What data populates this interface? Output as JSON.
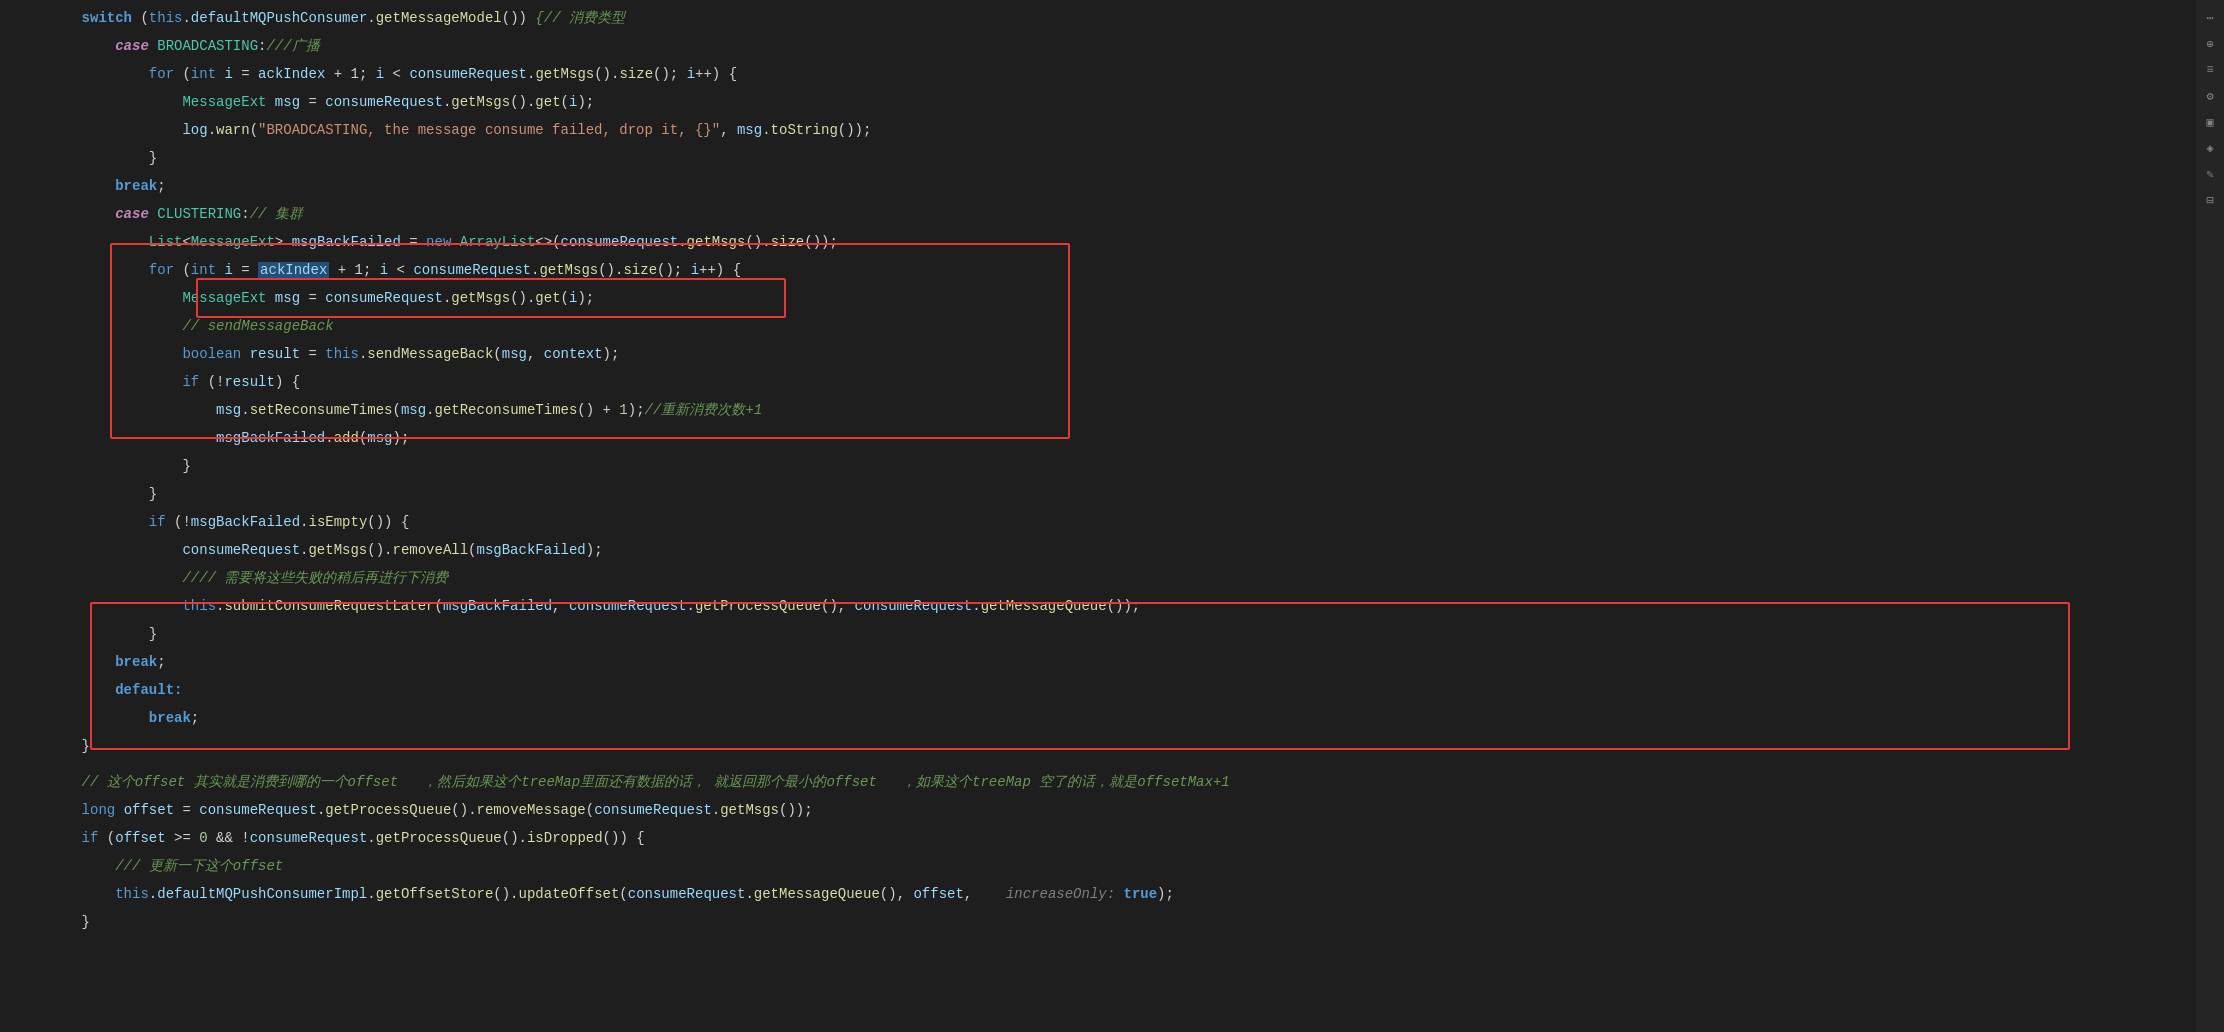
{
  "editor": {
    "background": "#1e1e1e",
    "font_size": "14px"
  },
  "lines": [
    {
      "indent": 2,
      "content": "switch_line",
      "text": "switch (this.defaultMQPushConsumer.getMessageModel()) {// 消费类型"
    },
    {
      "indent": 3,
      "content": "case_broadcasting",
      "text": "case BROADCASTING:///广播"
    },
    {
      "indent": 4,
      "content": "for_broadcasting",
      "text": "for (int i = ackIndex + 1; i < consumeRequest.getMsgs().size(); i++) {"
    },
    {
      "indent": 5,
      "content": "messageext_broadcasting",
      "text": "MessageExt msg = consumeRequest.getMsgs().get(i);"
    },
    {
      "indent": 5,
      "content": "log_warn",
      "text": "log.warn(\"BROADCASTING, the message consume failed, drop it, {}\", msg.toString());"
    },
    {
      "indent": 4,
      "content": "close_brace",
      "text": "}"
    },
    {
      "indent": 3,
      "content": "break_broadcasting",
      "text": "break;"
    },
    {
      "indent": 3,
      "content": "case_clustering",
      "text": "case CLUSTERING:// 集群"
    },
    {
      "indent": 4,
      "content": "list_line",
      "text": "List<MessageExt> msgBackFailed = new ArrayList<>(consumeRequest.getMsgs().size());"
    },
    {
      "indent": 4,
      "content": "for_clustering",
      "text": "for (int i = ackIndex + 1; i < consumeRequest.getMsgs().size(); i++) {"
    },
    {
      "indent": 5,
      "content": "messageext_clustering",
      "text": "MessageExt msg = consumeRequest.getMsgs().get(i);"
    },
    {
      "indent": 5,
      "content": "comment_send",
      "text": "// sendMessageBack"
    },
    {
      "indent": 5,
      "content": "boolean_result",
      "text": "boolean result = this.sendMessageBack(msg, context);"
    },
    {
      "indent": 5,
      "content": "if_result",
      "text": "if (!result) {"
    },
    {
      "indent": 6,
      "content": "set_reconsume",
      "text": "msg.setReconsumeTimes(msg.getReconsumeTimes() + 1);//重新消费次数+1"
    },
    {
      "indent": 6,
      "content": "add_failed",
      "text": "msgBackFailed.add(msg);"
    },
    {
      "indent": 5,
      "content": "close_if",
      "text": "}"
    },
    {
      "indent": 4,
      "content": "close_for",
      "text": "}"
    },
    {
      "indent": 4,
      "content": "if_not_empty",
      "text": "if (!msgBackFailed.isEmpty()) {"
    },
    {
      "indent": 5,
      "content": "remove_all",
      "text": "consumeRequest.getMsgs().removeAll(msgBackFailed);"
    },
    {
      "indent": 5,
      "content": "comment_later",
      "text": "//// 需要将这些失败的稍后再进行下消费"
    },
    {
      "indent": 5,
      "content": "submit_later",
      "text": "this.submitConsumeRequestLater(msgBackFailed, consumeRequest.getProcessQueue(), consumeRequest.getMessageQueue());"
    },
    {
      "indent": 4,
      "content": "close_if2",
      "text": "}"
    },
    {
      "indent": 3,
      "content": "break_clustering",
      "text": "break;"
    },
    {
      "indent": 3,
      "content": "default_label",
      "text": "default:"
    },
    {
      "indent": 4,
      "content": "break_default",
      "text": "break;"
    },
    {
      "indent": 2,
      "content": "close_switch",
      "text": "}"
    },
    {
      "indent": 2,
      "content": "comment_offset",
      "text": "// 这个offset 其实就是消费到哪的一个offset   ，然后如果这个treeMap里面还有数据的话，  就返回那个最小的offset   ，如果这个treeMap 空了的话，就是offsetMax+1"
    },
    {
      "indent": 2,
      "content": "long_offset",
      "text": "long offset = consumeRequest.getProcessQueue().removeMessage(consumeRequest.getMsgs());"
    },
    {
      "indent": 2,
      "content": "if_offset",
      "text": "if (offset >= 0 && !consumeRequest.getProcessQueue().isDropped()) {"
    },
    {
      "indent": 3,
      "content": "comment_update",
      "text": "/// 更新一下这个offset"
    },
    {
      "indent": 3,
      "content": "update_offset",
      "text": "this.defaultMQPushConsumerImpl.getOffsetStore().updateOffset(consumeRequest.getMessageQueue(), offset,    increaseOnly: true);"
    },
    {
      "indent": 2,
      "content": "close_if3",
      "text": "}"
    }
  ]
}
